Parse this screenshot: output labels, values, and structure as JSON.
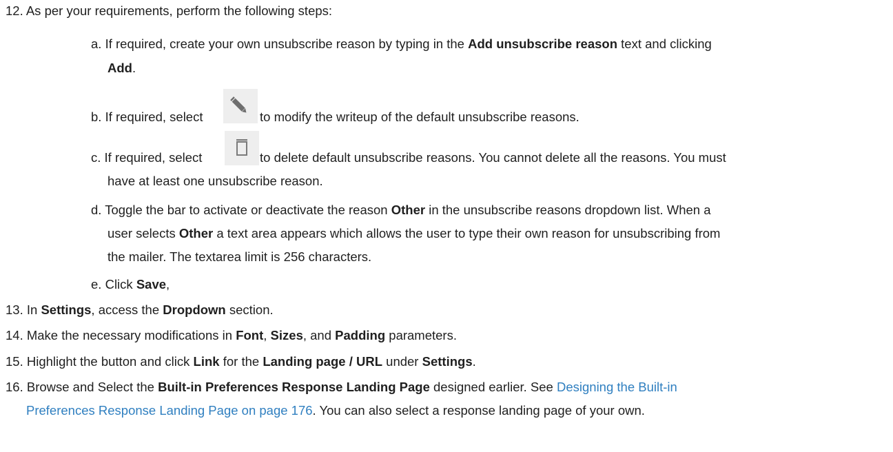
{
  "step12": {
    "num": "12.",
    "text": " As per your requirements, perform the following steps:",
    "a": {
      "label": "a.",
      "t1": " If required, create your own unsubscribe reason by typing in the ",
      "b1": "Add unsubscribe reason",
      "t2": " text and clicking",
      "b2": "Add",
      "t3": "."
    },
    "b": {
      "label": "b.",
      "t1": " If required, select ",
      "icon": "pencil-icon",
      "t2": " to modify the writeup of the default unsubscribe reasons."
    },
    "c": {
      "label": "c.",
      "t1": " If required, select ",
      "icon": "trash-icon",
      "t2": " to delete default unsubscribe reasons. You cannot delete all the reasons. You must",
      "t3": "have at least one unsubscribe reason."
    },
    "d": {
      "label": "d.",
      "t1": " Toggle the bar to activate or deactivate the reason ",
      "b1": "Other",
      "t2": " in the unsubscribe reasons dropdown list. When a",
      "t3": "user selects ",
      "b2": "Other",
      "t4": " a text area appears which allows the user to type their own reason for unsubscribing from",
      "t5": "the mailer. The textarea limit is 256 characters."
    },
    "e": {
      "label": "e.",
      "t1": " Click ",
      "b1": "Save",
      "t2": ","
    }
  },
  "step13": {
    "num": "13.",
    "t1": " In ",
    "b1": "Settings",
    "t2": ", access the ",
    "b2": "Dropdown",
    "t3": " section."
  },
  "step14": {
    "num": "14.",
    "t1": " Make the necessary modifications in ",
    "b1": "Font",
    "t2": ", ",
    "b2": "Sizes",
    "t3": ", and ",
    "b3": "Padding",
    "t4": " parameters."
  },
  "step15": {
    "num": "15.",
    "t1": " Highlight the button and click ",
    "b1": "Link",
    "t2": " for the ",
    "b2": "Landing page / URL",
    "t3": " under ",
    "b3": "Settings",
    "t4": "."
  },
  "step16": {
    "num": "16.",
    "t1": " Browse and Select the ",
    "b1": "Built-in Preferences Response Landing Page",
    "t2": " designed earlier. See ",
    "link1": "Designing the Built-in",
    "link2": "Preferences Response Landing Page on page 176",
    "t3": ". You can also select a response landing page of your own."
  },
  "colors": {
    "text": "#1f1f1f",
    "link": "#2f7fc0",
    "icon_bg": "#eeeeee",
    "pencil": "#6e6e6e",
    "trash": "#7a7a7a"
  }
}
